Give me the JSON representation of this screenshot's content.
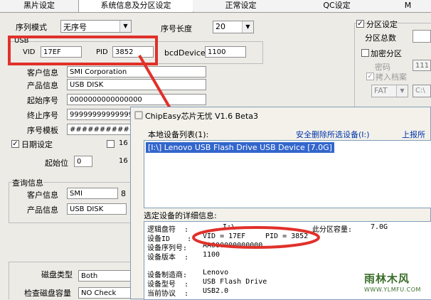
{
  "tabs": [
    "黑片设定",
    "系统信息及分区设定",
    "正常设定",
    "QC设定",
    "M"
  ],
  "serial_mode": {
    "label": "序列模式",
    "value": "无序号"
  },
  "serial_length": {
    "label": "序号长度",
    "value": "20"
  },
  "usb_group": {
    "title": "USB",
    "vid_label": "VID",
    "vid_value": "17EF",
    "pid_label": "PID",
    "pid_value": "3852",
    "bcd_label": "bcdDevice",
    "bcd_value": "1100"
  },
  "customer_info": {
    "label": "客户信息",
    "value": "SMI Corporation"
  },
  "product_info": {
    "label": "产品信息",
    "value": "USB DISK"
  },
  "start_serial": {
    "label": "起始序号",
    "value": "0000000000000000"
  },
  "end_serial": {
    "label": "终止序号",
    "value": "9999999999999999"
  },
  "serial_template": {
    "label": "序号模板",
    "value": "################"
  },
  "date_setting": {
    "label": "日期设定",
    "checked": true,
    "right_value": "16",
    "right_value2": "16"
  },
  "start_pos": {
    "label": "起始位",
    "value": "0"
  },
  "query_group": {
    "title": "查询信息",
    "customer_label": "客户信息",
    "customer_value": "SMI",
    "customer_extra": "8",
    "product_label": "产品信息",
    "product_value": "USB DISK"
  },
  "disk_type": {
    "label": "磁盘类型",
    "value": "Both"
  },
  "check_capacity": {
    "label": "检查磁盘容量",
    "value": "NO Check"
  },
  "partition": {
    "label": "分区设定",
    "checked": true,
    "total_label": "分区总数",
    "encrypt_label": "加密分区",
    "password_label": "密码",
    "password_value": "111",
    "copy_label": "拷入档案",
    "fs_value": "FAT",
    "path_value": "C:\\"
  },
  "dialog": {
    "title": "ChipEasy芯片无忧 V1.6 Beta3",
    "device_list_label": "本地设备列表(1):",
    "safe_remove_link": "安全删除所选设备(I:)",
    "report_link": "上报所",
    "device_item": "[I:\\] Lenovo USB Flash Drive USB Device [7.0G]",
    "details_label": "选定设备的详细信息:",
    "details": {
      "drive_letter_label": "逻辑盘符  :",
      "drive_letter": "I:\\",
      "capacity_label": "此分区容量:",
      "capacity": "7.0G",
      "device_id_label": "设备ID    :",
      "vid_text": "VID = 17EF",
      "pid_text": "PID = 3852",
      "serial_label": "设备序列号:",
      "serial_value": "AA000000000000",
      "version_label": "设备版本  :",
      "version_value": "1100",
      "manufacturer_label": "设备制造商:",
      "manufacturer_value": "Lenovo",
      "model_label": "设备型号  :",
      "model_value": "USB Flash Drive",
      "protocol_label": "当前协议  :",
      "protocol_value": "USB2.0"
    }
  },
  "watermark": {
    "brand": "雨林木风",
    "url": "WWW.YLMFU.COM"
  },
  "colors": {
    "highlight": "#e0312a",
    "selection": "#3366cc",
    "link": "#0033aa"
  }
}
